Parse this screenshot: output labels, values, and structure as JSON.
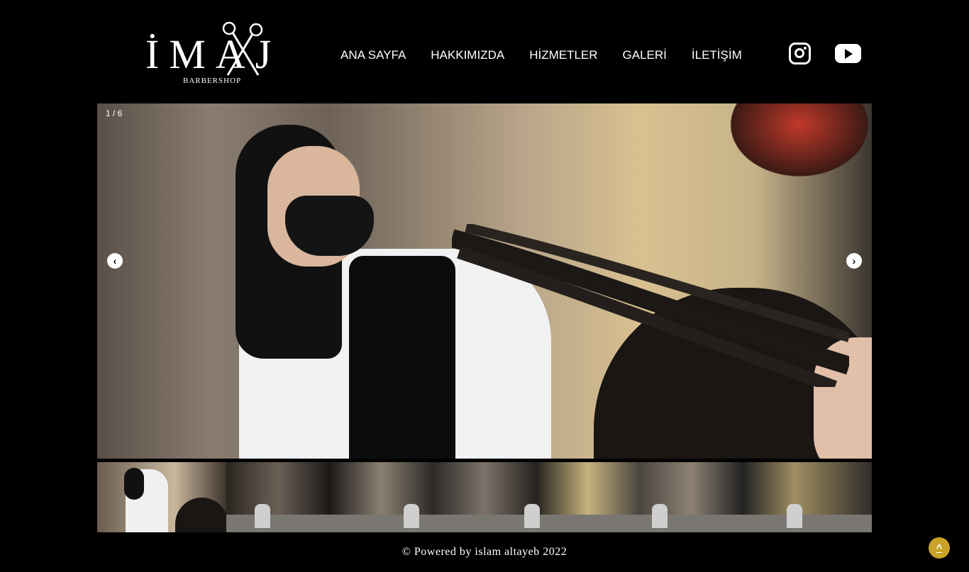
{
  "brand": {
    "name": "İMAJ",
    "tagline": "BARBERSHOP"
  },
  "nav": {
    "items": [
      {
        "label": "ANA SAYFA"
      },
      {
        "label": "HAKKIMIZDA"
      },
      {
        "label": "HİZMETLER"
      },
      {
        "label": "GALERİ"
      },
      {
        "label": "İLETİŞİM"
      }
    ]
  },
  "social": {
    "icons": [
      "instagram-icon",
      "youtube-icon"
    ]
  },
  "slider": {
    "counter": "1 / 6",
    "prev_icon": "chevron-left-icon",
    "next_icon": "chevron-right-icon",
    "total_slides": 6,
    "current_slide": 1
  },
  "footer": {
    "text": "© Powered by islam altayeb 2022"
  },
  "back_to_top": {
    "label": "^",
    "icon": "chevron-up-icon",
    "color": "#c9a227"
  },
  "colors": {
    "background": "#000000",
    "text": "#ffffff",
    "accent": "#c9a227"
  }
}
